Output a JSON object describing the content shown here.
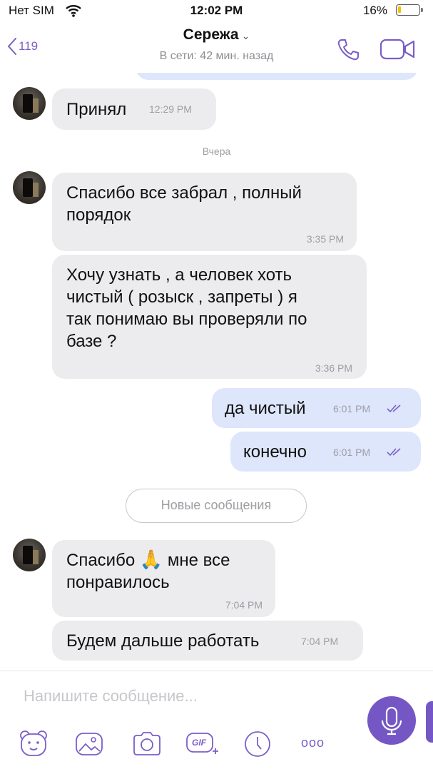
{
  "status_bar": {
    "carrier": "Нет SIM",
    "time": "12:02 PM",
    "battery": "16%",
    "battery_level": 0.16
  },
  "header": {
    "back_count": "119",
    "contact_name": "Сережа",
    "contact_status": "В сети: 42 мин. назад"
  },
  "messages": [
    {
      "side": "in",
      "text": "Принял",
      "time": "12:29 PM"
    },
    {
      "type": "date",
      "text": "Вчера"
    },
    {
      "side": "in",
      "text": "Спасибо все забрал , полный порядок",
      "lines": [
        "Спасибо все забрал , полный",
        "порядок"
      ],
      "time": "3:35 PM"
    },
    {
      "side": "in",
      "text": "Хочу узнать , а человек хоть чистый ( розыск , запреты ) я так понимаю вы проверяли по базе ?",
      "lines": [
        "Хочу узнать , а человек хоть",
        "чистый ( розыск , запреты ) я",
        "так понимаю вы проверяли по",
        "базе ?"
      ],
      "time": "3:36 PM"
    },
    {
      "side": "out",
      "text": "да чистый",
      "time": "6:01 PM",
      "status": "read"
    },
    {
      "side": "out",
      "text": "конечно",
      "time": "6:01 PM",
      "status": "read"
    },
    {
      "type": "new_messages",
      "text": "Новые сообщения"
    },
    {
      "side": "in",
      "text": "Спасибо 🙏 мне все понравилось",
      "lines": [
        "Спасибо",
        "мне все",
        "понравилось"
      ],
      "emoji": "🙏",
      "time": "7:04 PM"
    },
    {
      "side": "in",
      "text": "Будем дальше работать",
      "time": "7:04 PM"
    }
  ],
  "composer": {
    "placeholder": "Напишите сообщение...",
    "toolbar": [
      "sticker-icon",
      "gallery-icon",
      "camera-icon",
      "gif-icon",
      "clock-icon",
      "more-icon"
    ],
    "gif_label": "GIF",
    "more_label": "ooo"
  },
  "colors": {
    "accent": "#7457c4",
    "incoming_bubble": "#ececee",
    "outgoing_bubble": "#dde6fb",
    "read_ticks": "#7b5ec6"
  }
}
